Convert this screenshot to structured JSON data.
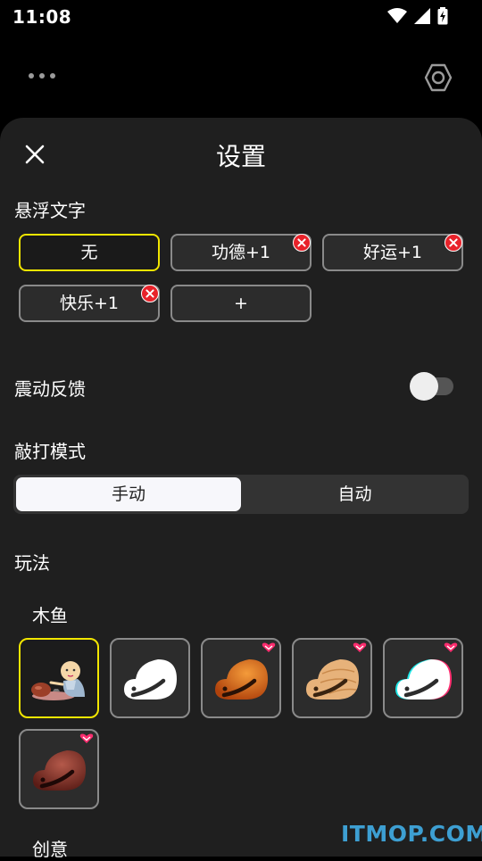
{
  "status_bar": {
    "time": "11:08",
    "icons": [
      "wifi-icon",
      "signal-icon",
      "battery-icon"
    ]
  },
  "top_bar": {
    "icons": [
      "more-icon",
      "settings-icon"
    ]
  },
  "settings": {
    "title": "设置",
    "floating_text": {
      "heading": "悬浮文字",
      "options": [
        "无",
        "功德+1",
        "好运+1",
        "快乐+1"
      ],
      "selected": "无",
      "add_label": "+"
    },
    "vibration": {
      "label": "震动反馈",
      "enabled": false
    },
    "tap_mode": {
      "heading": "敲打模式",
      "options": [
        "手动",
        "自动"
      ],
      "selected": "手动"
    },
    "gameplay": {
      "heading": "玩法",
      "wooden_fish": {
        "heading": "木鱼",
        "skins": [
          {
            "name": "monk",
            "selected": true,
            "vip": false
          },
          {
            "name": "white",
            "selected": false,
            "vip": false
          },
          {
            "name": "orange",
            "selected": false,
            "vip": true
          },
          {
            "name": "wood",
            "selected": false,
            "vip": true
          },
          {
            "name": "glitch",
            "selected": false,
            "vip": true
          },
          {
            "name": "mahogany",
            "selected": false,
            "vip": true
          }
        ]
      },
      "creative_heading": "创意"
    }
  },
  "colors": {
    "accent_selected": "#f2e600",
    "delete_badge": "#e8222a",
    "vip_badge": "#ff2d6f",
    "sheet_bg": "#1f1f1f"
  },
  "watermark": "ITMOP.COM"
}
